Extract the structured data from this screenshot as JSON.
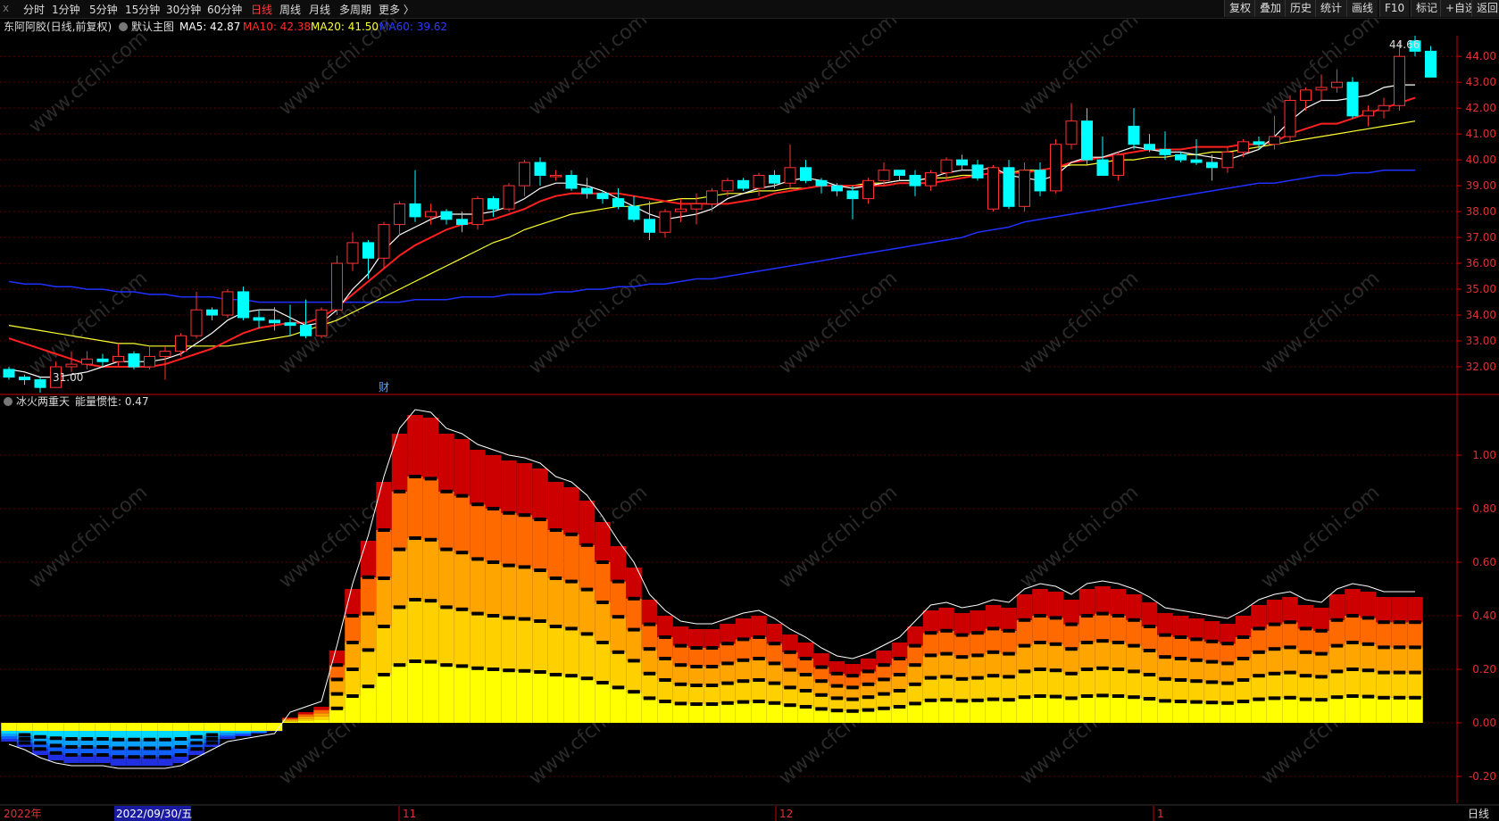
{
  "toolbar": {
    "close_glyph": "x",
    "timeframes": [
      "分时",
      "1分钟",
      "5分钟",
      "15分钟",
      "30分钟",
      "60分钟",
      "日线",
      "周线",
      "月线",
      "多周期",
      "更多 〉"
    ],
    "active_timeframe": "日线",
    "right_buttons": [
      "复权",
      "叠加",
      "历史",
      "统计",
      "画线",
      "F10",
      "标记",
      "+自选",
      "返回"
    ]
  },
  "main_panel": {
    "stock_label": "东阿阿胶(日线,前复权)",
    "indicator_name": "默认主图",
    "ma_labels": [
      {
        "text": "MA5: 42.87",
        "color": "#ffffff"
      },
      {
        "text": "MA10: 42.38",
        "color": "#ff2b2b"
      },
      {
        "text": "MA20: 41.50",
        "color": "#ffff33"
      },
      {
        "text": "MA60: 39.62",
        "color": "#2b3bff"
      }
    ],
    "high_marker": "44.66",
    "low_marker": "31.00",
    "event_marker": "财",
    "y_ticks": [
      "44.00",
      "43.00",
      "42.00",
      "41.00",
      "40.00",
      "39.00",
      "38.00",
      "37.00",
      "36.00",
      "35.00",
      "34.00",
      "33.00",
      "32.00"
    ]
  },
  "sub_panel": {
    "indicator_name": "冰火两重天",
    "value_label": "能量惯性: 0.47",
    "y_ticks": [
      "1.00",
      "0.80",
      "0.60",
      "0.40",
      "0.20",
      "0.00",
      "-0.20"
    ]
  },
  "x_axis": {
    "labels": [
      "2022年",
      "2022/09/30/五",
      "11",
      "12",
      "1"
    ],
    "period_badge": "日线"
  },
  "watermark": "www.cfchi.com",
  "colors": {
    "up": "#ff3333",
    "down": "#00ffff",
    "grid": "#5a0000",
    "axis": "#cc0000",
    "ma5": "#ffffff",
    "ma10": "#ff2020",
    "ma20": "#ffff33",
    "ma60": "#2030ff"
  },
  "chart_data": [
    {
      "type": "candlestick",
      "title": "东阿阿胶(日线,前复权)",
      "ylim": [
        31.0,
        44.8
      ],
      "ohlc": [
        [
          31.9,
          32.0,
          31.5,
          31.6
        ],
        [
          31.6,
          31.7,
          31.3,
          31.5
        ],
        [
          31.5,
          31.6,
          31.0,
          31.2
        ],
        [
          31.2,
          32.2,
          31.2,
          32.0
        ],
        [
          32.0,
          32.6,
          31.8,
          32.1
        ],
        [
          32.1,
          32.6,
          31.9,
          32.3
        ],
        [
          32.3,
          32.5,
          32.0,
          32.2
        ],
        [
          32.2,
          32.9,
          32.0,
          32.4
        ],
        [
          32.5,
          32.6,
          31.9,
          32.0
        ],
        [
          32.0,
          32.8,
          31.9,
          32.4
        ],
        [
          32.4,
          32.8,
          31.5,
          32.6
        ],
        [
          32.6,
          33.3,
          32.4,
          33.2
        ],
        [
          33.2,
          34.9,
          33.1,
          34.2
        ],
        [
          34.2,
          34.3,
          33.8,
          34.0
        ],
        [
          34.0,
          35.0,
          33.9,
          34.9
        ],
        [
          34.9,
          35.1,
          33.8,
          33.9
        ],
        [
          33.9,
          34.2,
          33.5,
          33.8
        ],
        [
          33.8,
          34.3,
          33.4,
          33.7
        ],
        [
          33.7,
          34.4,
          33.2,
          33.6
        ],
        [
          33.6,
          34.6,
          33.1,
          33.2
        ],
        [
          33.2,
          34.3,
          33.1,
          34.2
        ],
        [
          34.2,
          36.3,
          34.0,
          36.0
        ],
        [
          36.0,
          37.2,
          35.7,
          36.8
        ],
        [
          36.8,
          36.9,
          35.4,
          36.2
        ],
        [
          36.2,
          37.6,
          35.8,
          37.5
        ],
        [
          37.5,
          38.4,
          37.1,
          38.3
        ],
        [
          38.3,
          39.6,
          37.6,
          37.8
        ],
        [
          37.8,
          38.3,
          37.5,
          38.0
        ],
        [
          38.0,
          38.1,
          37.5,
          37.7
        ],
        [
          37.7,
          38.0,
          37.2,
          37.5
        ],
        [
          37.5,
          38.6,
          37.3,
          38.5
        ],
        [
          38.5,
          38.6,
          37.8,
          38.1
        ],
        [
          38.1,
          39.1,
          38.0,
          39.0
        ],
        [
          39.0,
          40.0,
          38.6,
          39.9
        ],
        [
          39.9,
          40.1,
          39.0,
          39.4
        ],
        [
          39.4,
          39.6,
          39.2,
          39.4
        ],
        [
          39.4,
          39.6,
          38.8,
          38.9
        ],
        [
          38.9,
          39.3,
          38.5,
          38.7
        ],
        [
          38.7,
          38.8,
          38.3,
          38.5
        ],
        [
          38.5,
          38.9,
          38.1,
          38.2
        ],
        [
          38.2,
          38.6,
          37.6,
          37.7
        ],
        [
          37.7,
          38.4,
          36.9,
          37.2
        ],
        [
          37.2,
          38.1,
          37.0,
          38.0
        ],
        [
          38.0,
          38.5,
          37.6,
          38.1
        ],
        [
          38.1,
          38.7,
          37.5,
          38.3
        ],
        [
          38.3,
          38.9,
          38.0,
          38.8
        ],
        [
          38.8,
          39.3,
          38.6,
          39.2
        ],
        [
          39.2,
          39.3,
          38.8,
          38.9
        ],
        [
          38.9,
          39.5,
          38.6,
          39.4
        ],
        [
          39.4,
          39.6,
          38.9,
          39.1
        ],
        [
          39.1,
          40.6,
          38.9,
          39.7
        ],
        [
          39.7,
          40.0,
          39.1,
          39.2
        ],
        [
          39.2,
          39.3,
          38.7,
          39.0
        ],
        [
          39.0,
          39.1,
          38.6,
          38.8
        ],
        [
          38.8,
          39.0,
          37.7,
          38.5
        ],
        [
          38.5,
          39.3,
          38.3,
          39.2
        ],
        [
          39.2,
          39.9,
          39.0,
          39.6
        ],
        [
          39.6,
          39.6,
          39.2,
          39.4
        ],
        [
          39.4,
          39.6,
          38.6,
          39.0
        ],
        [
          39.0,
          39.6,
          38.8,
          39.5
        ],
        [
          39.5,
          40.1,
          39.2,
          40.0
        ],
        [
          40.0,
          40.2,
          39.6,
          39.8
        ],
        [
          39.8,
          40.0,
          39.2,
          39.3
        ],
        [
          38.1,
          39.8,
          38.0,
          39.7
        ],
        [
          39.7,
          40.0,
          38.1,
          38.2
        ],
        [
          38.2,
          39.9,
          38.0,
          39.6
        ],
        [
          39.6,
          39.9,
          38.6,
          38.8
        ],
        [
          38.8,
          40.8,
          38.7,
          40.6
        ],
        [
          40.6,
          42.2,
          40.4,
          41.5
        ],
        [
          41.5,
          42.0,
          39.8,
          40.0
        ],
        [
          40.0,
          40.9,
          39.4,
          39.4
        ],
        [
          39.4,
          40.3,
          39.2,
          40.2
        ],
        [
          41.3,
          42.0,
          40.4,
          40.6
        ],
        [
          40.6,
          41.0,
          40.3,
          40.4
        ],
        [
          40.4,
          41.1,
          40.0,
          40.2
        ],
        [
          40.2,
          40.3,
          39.9,
          40.0
        ],
        [
          40.0,
          40.8,
          39.8,
          39.9
        ],
        [
          39.9,
          40.2,
          39.2,
          39.7
        ],
        [
          39.7,
          40.5,
          39.5,
          40.3
        ],
        [
          40.3,
          40.8,
          40.1,
          40.7
        ],
        [
          40.7,
          40.9,
          40.4,
          40.6
        ],
        [
          40.6,
          41.7,
          40.4,
          40.9
        ],
        [
          40.9,
          42.5,
          40.7,
          42.3
        ],
        [
          42.3,
          42.8,
          41.9,
          42.7
        ],
        [
          42.7,
          43.3,
          42.3,
          42.8
        ],
        [
          42.8,
          43.5,
          42.6,
          43.0
        ],
        [
          43.0,
          43.2,
          41.6,
          41.7
        ],
        [
          41.7,
          42.1,
          41.3,
          41.9
        ],
        [
          41.9,
          42.4,
          41.6,
          42.1
        ],
        [
          42.1,
          44.6,
          41.9,
          44.0
        ],
        [
          44.6,
          44.8,
          44.0,
          44.2
        ],
        [
          44.2,
          44.4,
          43.2,
          43.2
        ]
      ],
      "ma5": [
        31.9,
        31.8,
        31.6,
        31.6,
        31.7,
        31.8,
        32.0,
        32.2,
        32.2,
        32.2,
        32.3,
        32.5,
        32.9,
        33.3,
        33.8,
        34.1,
        34.2,
        34.2,
        33.9,
        33.6,
        33.7,
        34.2,
        35.0,
        35.6,
        36.5,
        37.1,
        37.4,
        37.7,
        37.9,
        37.9,
        37.9,
        38.0,
        38.2,
        38.5,
        38.9,
        39.1,
        39.1,
        39.0,
        38.8,
        38.5,
        38.2,
        37.9,
        37.7,
        37.8,
        37.9,
        38.1,
        38.5,
        38.7,
        38.9,
        39.0,
        39.2,
        39.3,
        39.2,
        39.0,
        38.9,
        39.0,
        39.1,
        39.2,
        39.2,
        39.3,
        39.5,
        39.6,
        39.6,
        39.7,
        39.4,
        39.3,
        39.2,
        39.4,
        39.9,
        40.1,
        40.1,
        40.3,
        40.5,
        40.4,
        40.3,
        40.3,
        40.2,
        40.1,
        40.0,
        40.2,
        40.4,
        40.9,
        41.5,
        42.0,
        42.3,
        42.3,
        42.4,
        42.5,
        42.8,
        42.9,
        42.9
      ],
      "ma10": [
        33.1,
        32.9,
        32.7,
        32.5,
        32.3,
        32.1,
        32.0,
        32.0,
        32.0,
        32.0,
        32.1,
        32.3,
        32.5,
        32.7,
        33.0,
        33.3,
        33.5,
        33.6,
        33.7,
        33.7,
        33.9,
        34.3,
        34.8,
        35.3,
        35.8,
        36.3,
        36.7,
        37.0,
        37.3,
        37.5,
        37.6,
        37.7,
        37.9,
        38.1,
        38.4,
        38.6,
        38.7,
        38.7,
        38.7,
        38.7,
        38.6,
        38.5,
        38.4,
        38.3,
        38.3,
        38.3,
        38.3,
        38.4,
        38.5,
        38.7,
        38.8,
        38.9,
        39.0,
        39.0,
        39.0,
        39.0,
        39.0,
        39.1,
        39.1,
        39.1,
        39.2,
        39.3,
        39.4,
        39.5,
        39.5,
        39.5,
        39.6,
        39.7,
        39.9,
        40.0,
        40.1,
        40.2,
        40.3,
        40.4,
        40.4,
        40.4,
        40.5,
        40.5,
        40.5,
        40.6,
        40.6,
        40.7,
        41.0,
        41.2,
        41.4,
        41.4,
        41.6,
        41.8,
        42.0,
        42.2,
        42.4
      ],
      "ma20": [
        33.6,
        33.5,
        33.4,
        33.3,
        33.2,
        33.1,
        33.0,
        32.9,
        32.9,
        32.8,
        32.8,
        32.8,
        32.8,
        32.8,
        32.8,
        32.9,
        33.0,
        33.1,
        33.2,
        33.4,
        33.6,
        33.8,
        34.1,
        34.4,
        34.7,
        35.0,
        35.3,
        35.6,
        35.9,
        36.2,
        36.5,
        36.8,
        37.0,
        37.3,
        37.5,
        37.7,
        37.9,
        38.0,
        38.1,
        38.2,
        38.2,
        38.3,
        38.4,
        38.5,
        38.5,
        38.6,
        38.7,
        38.7,
        38.8,
        38.8,
        38.9,
        38.9,
        39.0,
        39.0,
        39.0,
        39.1,
        39.1,
        39.2,
        39.2,
        39.3,
        39.3,
        39.4,
        39.4,
        39.5,
        39.5,
        39.6,
        39.6,
        39.7,
        39.8,
        39.8,
        39.9,
        40.0,
        40.0,
        40.1,
        40.1,
        40.2,
        40.2,
        40.3,
        40.3,
        40.4,
        40.5,
        40.6,
        40.7,
        40.8,
        40.9,
        41.0,
        41.1,
        41.2,
        41.3,
        41.4,
        41.5
      ],
      "ma60": [
        35.3,
        35.2,
        35.2,
        35.1,
        35.1,
        35.0,
        35.0,
        34.9,
        34.9,
        34.8,
        34.8,
        34.7,
        34.7,
        34.7,
        34.6,
        34.6,
        34.5,
        34.5,
        34.5,
        34.5,
        34.5,
        34.5,
        34.5,
        34.5,
        34.5,
        34.5,
        34.6,
        34.6,
        34.6,
        34.7,
        34.7,
        34.7,
        34.8,
        34.8,
        34.8,
        34.9,
        34.9,
        35.0,
        35.0,
        35.1,
        35.1,
        35.2,
        35.2,
        35.3,
        35.4,
        35.4,
        35.5,
        35.6,
        35.7,
        35.8,
        35.9,
        36.0,
        36.1,
        36.2,
        36.3,
        36.4,
        36.5,
        36.6,
        36.7,
        36.8,
        36.9,
        37.0,
        37.2,
        37.3,
        37.4,
        37.6,
        37.7,
        37.8,
        37.9,
        38.0,
        38.1,
        38.2,
        38.3,
        38.4,
        38.5,
        38.6,
        38.7,
        38.8,
        38.9,
        39.0,
        39.1,
        39.1,
        39.2,
        39.3,
        39.4,
        39.4,
        39.5,
        39.5,
        39.6,
        39.6,
        39.6
      ]
    },
    {
      "type": "area",
      "title": "冰火两重天",
      "ylim": [
        -0.3,
        1.15
      ],
      "values": [
        -0.03,
        -0.04,
        -0.05,
        -0.05,
        -0.05,
        -0.06,
        -0.06,
        -0.07,
        -0.07,
        -0.07,
        -0.07,
        -0.06,
        -0.06,
        -0.05,
        -0.04,
        -0.03,
        -0.02,
        -0.01,
        0.02,
        0.04,
        0.06,
        0.27,
        0.5,
        0.68,
        0.9,
        1.08,
        1.15,
        1.14,
        1.08,
        1.06,
        1.02,
        1.0,
        0.98,
        0.97,
        0.95,
        0.9,
        0.88,
        0.83,
        0.75,
        0.66,
        0.58,
        0.46,
        0.4,
        0.36,
        0.35,
        0.35,
        0.37,
        0.39,
        0.4,
        0.37,
        0.33,
        0.3,
        0.26,
        0.23,
        0.22,
        0.24,
        0.27,
        0.3,
        0.36,
        0.42,
        0.43,
        0.41,
        0.42,
        0.44,
        0.43,
        0.48,
        0.5,
        0.49,
        0.46,
        0.5,
        0.51,
        0.5,
        0.48,
        0.45,
        0.41,
        0.4,
        0.39,
        0.38,
        0.37,
        0.4,
        0.44,
        0.46,
        0.47,
        0.44,
        0.43,
        0.48,
        0.5,
        0.49,
        0.47,
        0.47,
        0.47
      ],
      "negative_depth": [
        0.04,
        0.06,
        0.09,
        0.11,
        0.12,
        0.12,
        0.12,
        0.13,
        0.13,
        0.13,
        0.13,
        0.12,
        0.09,
        0.06,
        0.03,
        0.02,
        0.01,
        0.0
      ]
    }
  ]
}
